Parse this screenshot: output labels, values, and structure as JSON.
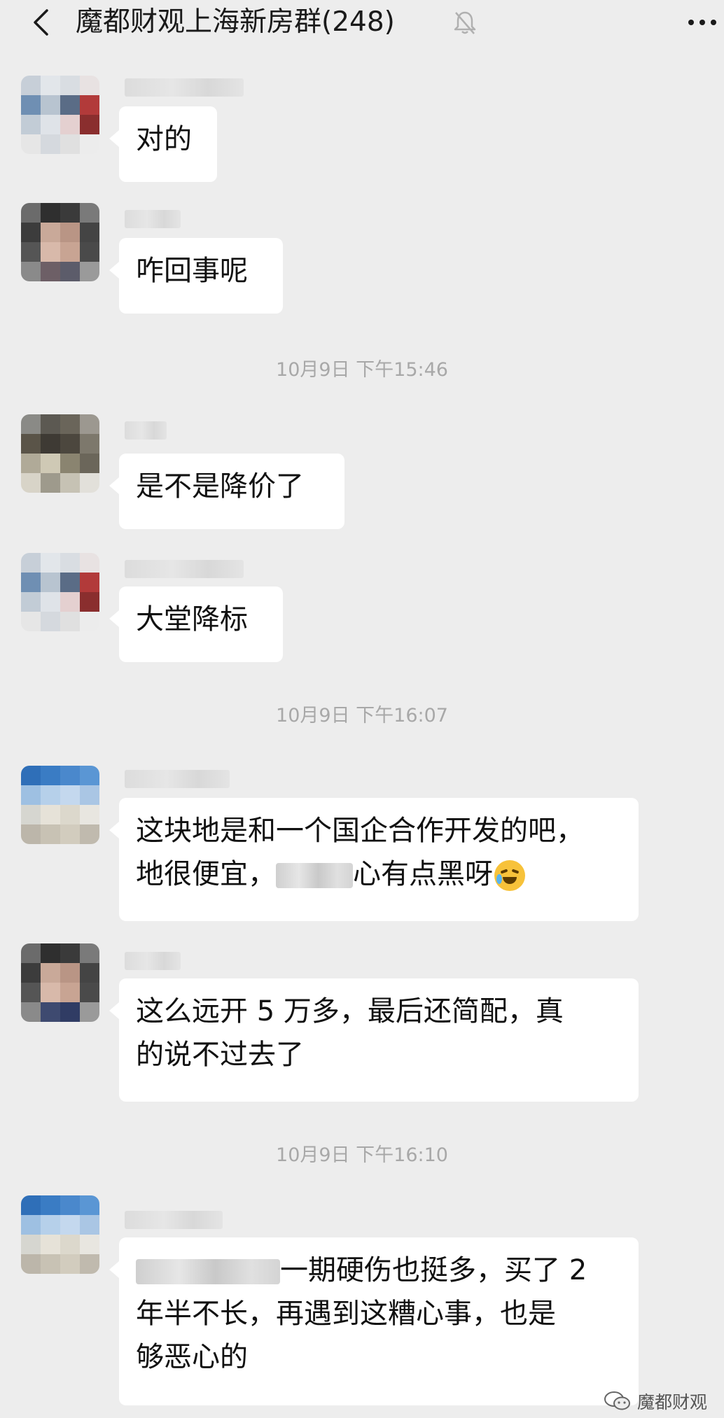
{
  "header": {
    "title": "魔都财观上海新房群(248)",
    "back_icon": "chevron-left-icon",
    "mute_icon": "bell-off-icon",
    "more_icon": "more-dots-icon"
  },
  "messages": [
    {
      "text": "对的"
    },
    {
      "text": "咋回事呢"
    },
    {
      "text": "是不是降价了"
    },
    {
      "text": "大堂降标"
    },
    {
      "line1": "这块地是和一个国企合作开发的吧，",
      "line2_after_redaction": "心有点黑呀",
      "line2_before_redaction": "地很便宜，",
      "emoji": "face-with-tears-icon"
    },
    {
      "line1": "这么远开 5 万多，最后还简配，真",
      "line2": "的说不过去了"
    },
    {
      "line1_after_redaction": "一期硬伤也挺多，买了 2",
      "line2": "年半不长，再遇到这糟心事，也是",
      "line3": "够恶心的"
    }
  ],
  "timestamps": [
    "10月9日 下午15:46",
    "10月9日 下午16:07",
    "10月9日 下午16:10"
  ],
  "watermark": {
    "text": "魔都财观",
    "icon": "wechat-official-account-icon"
  }
}
